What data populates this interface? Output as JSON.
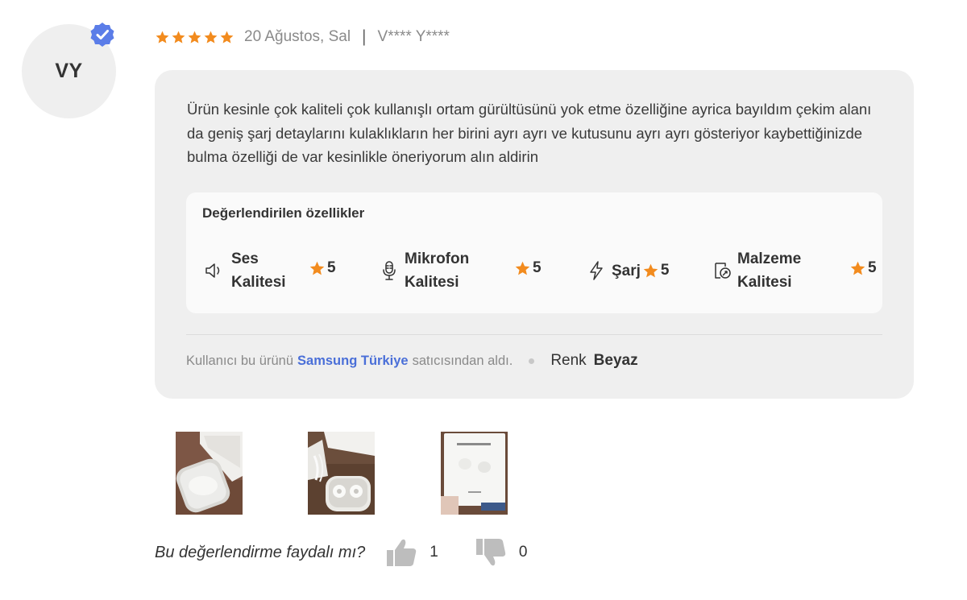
{
  "reviewer": {
    "initials": "VY",
    "rating": 5,
    "date": "20 Ağustos, Sal",
    "separator": "|",
    "name": "V**** Y****"
  },
  "review": {
    "text": "Ürün kesinle çok kaliteli çok kullanışlı ortam gürültüsünü yok etme özelliğine ayrica bayıldım çekim alanı da geniş şarj detaylarını kulaklıkların her birini ayrı ayrı ve kutusunu ayrı ayrı gösteriyor kaybettiğinizde bulma özelliği de var kesinlikle öneriyorum alın aldirin"
  },
  "features": {
    "title": "Değerlendirilen özellikler",
    "items": [
      {
        "icon": "speaker-icon",
        "name": "Ses\nKalitesi",
        "rating": "5"
      },
      {
        "icon": "microphone-icon",
        "name": "Mikrofon\nKalitesi",
        "rating": "5"
      },
      {
        "icon": "lightning-icon",
        "name": "Şarj",
        "rating": "5"
      },
      {
        "icon": "material-icon",
        "name": "Malzeme\nKalitesi",
        "rating": "5"
      }
    ]
  },
  "seller": {
    "prefix": "Kullanıcı bu ürünü",
    "store": "Samsung Türkiye",
    "suffix": "satıcısından aldı.",
    "color_label": "Renk",
    "color_value": "Beyaz"
  },
  "photos": [
    {
      "name": "review-photo-1"
    },
    {
      "name": "review-photo-2"
    },
    {
      "name": "review-photo-3"
    }
  ],
  "helpful": {
    "question": "Bu değerlendirme faydalı mı?",
    "likes": "1",
    "dislikes": "0"
  },
  "colors": {
    "star": "#f28b1e",
    "verified": "#5b7de8",
    "store_link": "#4a6fd8",
    "card_bg": "#efefef"
  }
}
